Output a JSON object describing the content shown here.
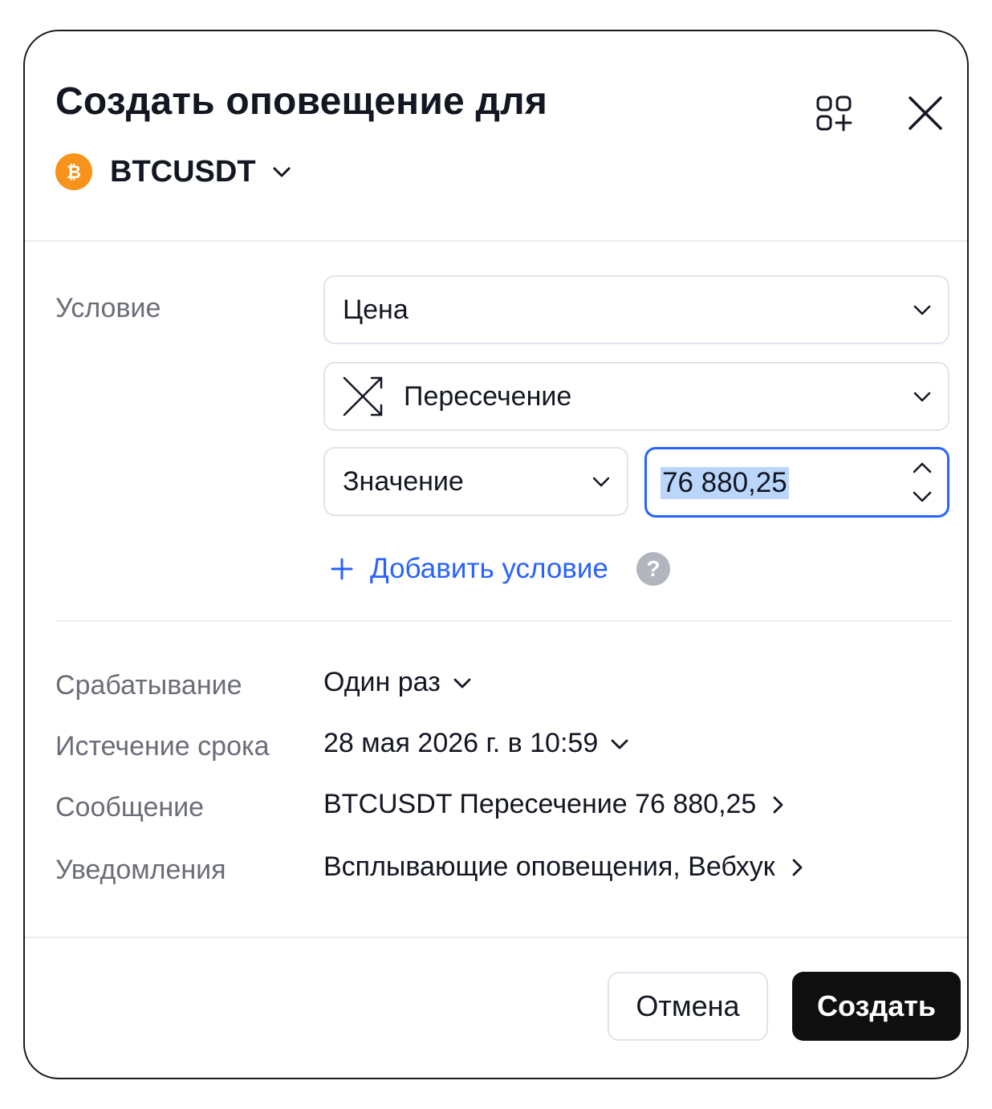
{
  "dialog": {
    "title": "Создать оповещение для",
    "symbol": "BTCUSDT",
    "coin_icon": "bitcoin-icon",
    "colors": {
      "coin": "#f7931a",
      "accent": "#2962ff",
      "primary_button": "#0f0f0f"
    }
  },
  "condition": {
    "label": "Условие",
    "source": "Цена",
    "operator": "Пересечение",
    "operator_icon": "crossing-icon",
    "value_type": "Значение",
    "value": "76 880,25",
    "add_condition": "Добавить условие",
    "help": "?"
  },
  "settings": {
    "trigger_label": "Срабатывание",
    "trigger_value": "Один раз",
    "expiration_label": "Истечение срока",
    "expiration_value": "28 мая 2026 г. в 10:59",
    "message_label": "Сообщение",
    "message_value": "BTCUSDT Пересечение 76 880,25",
    "notifications_label": "Уведомления",
    "notifications_value": "Всплывающие оповещения, Вебхук"
  },
  "footer": {
    "cancel_label": "Отмена",
    "create_label": "Создать"
  }
}
